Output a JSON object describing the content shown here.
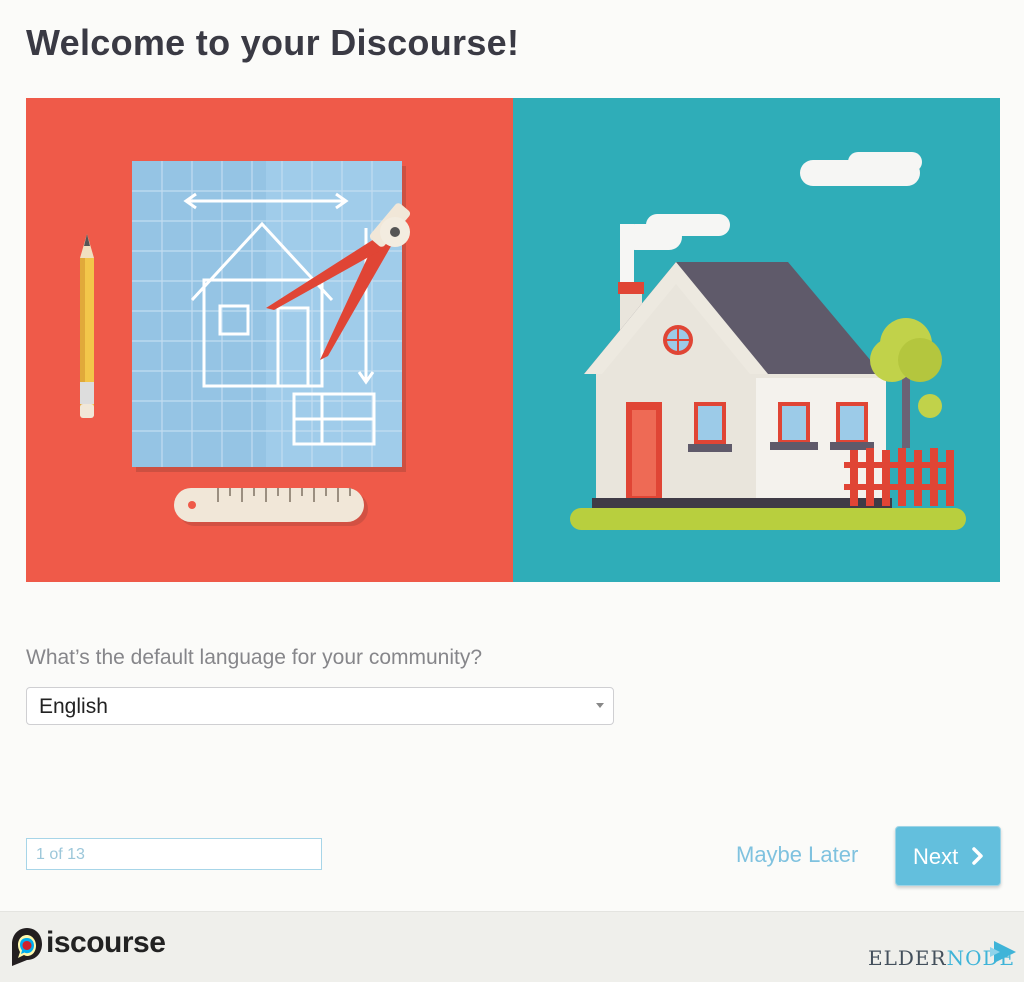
{
  "page": {
    "title": "Welcome to your Discourse!"
  },
  "language_step": {
    "question": "What’s the default language for your community?",
    "selected_language": "English"
  },
  "wizard": {
    "progress": "1 of 13",
    "maybe_later_label": "Maybe Later",
    "next_label": "Next"
  },
  "footer": {
    "discourse_logo_text": "iscourse",
    "eldernode_logo_text_main": "ELDER",
    "eldernode_logo_text_accent": "NODE"
  },
  "colors": {
    "accent_blue": "#63bfdd",
    "hero_left": "#ef5a49",
    "hero_right": "#2fadb8"
  },
  "icons": [
    "chevron-right-icon",
    "caret-down-icon",
    "discourse-logo-icon",
    "eldernode-logo-icon"
  ]
}
